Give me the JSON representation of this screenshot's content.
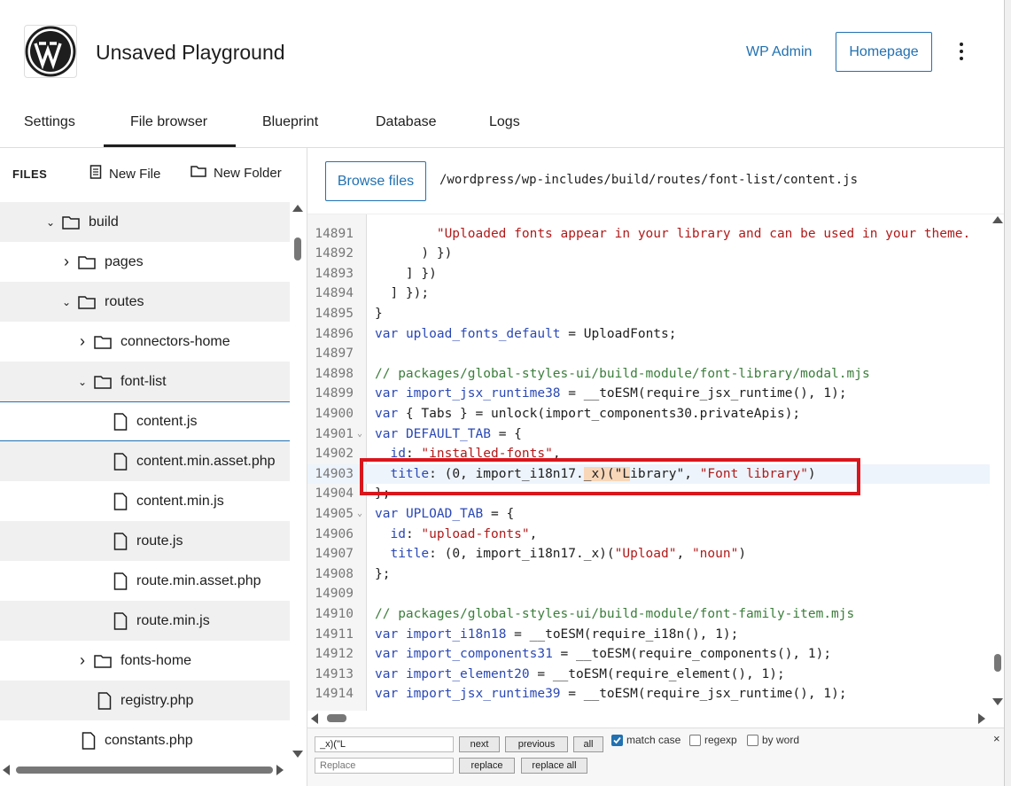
{
  "header": {
    "title": "Unsaved Playground",
    "wp_admin": "WP Admin",
    "homepage": "Homepage"
  },
  "tabs": [
    {
      "label": "Settings"
    },
    {
      "label": "File browser",
      "active": true
    },
    {
      "label": "Blueprint"
    },
    {
      "label": "Database"
    },
    {
      "label": "Logs"
    }
  ],
  "sidebar": {
    "files_label": "FILES",
    "new_file": "New File",
    "new_folder": "New Folder",
    "tree": [
      {
        "name": "build",
        "type": "folder",
        "expanded": true,
        "depth": 0
      },
      {
        "name": "pages",
        "type": "folder",
        "expanded": false,
        "depth": 1
      },
      {
        "name": "routes",
        "type": "folder",
        "expanded": true,
        "depth": 1
      },
      {
        "name": "connectors-home",
        "type": "folder",
        "expanded": false,
        "depth": 2
      },
      {
        "name": "font-list",
        "type": "folder",
        "expanded": true,
        "depth": 2
      },
      {
        "name": "content.js",
        "type": "file",
        "depth": 3,
        "selected": true
      },
      {
        "name": "content.min.asset.php",
        "type": "file",
        "depth": 3
      },
      {
        "name": "content.min.js",
        "type": "file",
        "depth": 3
      },
      {
        "name": "route.js",
        "type": "file",
        "depth": 3
      },
      {
        "name": "route.min.asset.php",
        "type": "file",
        "depth": 3
      },
      {
        "name": "route.min.js",
        "type": "file",
        "depth": 3
      },
      {
        "name": "fonts-home",
        "type": "folder",
        "expanded": false,
        "depth": 2
      },
      {
        "name": "registry.php",
        "type": "file",
        "depth": 2
      },
      {
        "name": "constants.php",
        "type": "file",
        "depth": 1
      }
    ]
  },
  "editor": {
    "browse_files": "Browse files",
    "path": "/wordpress/wp-includes/build/routes/font-list/content.js",
    "active_line": "14903",
    "lines": [
      {
        "n": "14891",
        "html": "        <span class='str'>\"Uploaded fonts appear in your library and can be used in your theme.</span>"
      },
      {
        "n": "14892",
        "html": "      ) })"
      },
      {
        "n": "14893",
        "html": "    ] })"
      },
      {
        "n": "14894",
        "html": "  ] });"
      },
      {
        "n": "14895",
        "html": "}"
      },
      {
        "n": "14896",
        "html": "<span class='kw'>var</span> <span class='kw'>upload_fonts_default</span> = UploadFonts;"
      },
      {
        "n": "14897",
        "html": ""
      },
      {
        "n": "14898",
        "html": "<span class='cmt'>// packages/global-styles-ui/build-module/font-library/modal.mjs</span>"
      },
      {
        "n": "14899",
        "html": "<span class='kw'>var</span> <span class='kw'>import_jsx_runtime38</span> = __toESM(require_jsx_runtime(), <span class='def'>1</span>);"
      },
      {
        "n": "14900",
        "html": "<span class='kw'>var</span> { Tabs } = unlock(import_components30.privateApis);"
      },
      {
        "n": "14901",
        "fold": true,
        "html": "<span class='kw'>var</span> <span class='kw'>DEFAULT_TAB</span> = {"
      },
      {
        "n": "14902",
        "html": "  <span class='kw'>id</span>: <span class='str'>\"installed-fonts\"</span>,"
      },
      {
        "n": "14903",
        "html": "  <span class='kw'>title</span>: (0, import_i18n17.<span class='hl'>_x)(\"L</span>ibrary\", <span class='str'>\"Font library\"</span>)"
      },
      {
        "n": "14904",
        "html": "};"
      },
      {
        "n": "14905",
        "fold": true,
        "html": "<span class='kw'>var</span> <span class='kw'>UPLOAD_TAB</span> = {"
      },
      {
        "n": "14906",
        "html": "  <span class='kw'>id</span>: <span class='str'>\"upload-fonts\"</span>,"
      },
      {
        "n": "14907",
        "html": "  <span class='kw'>title</span>: (0, import_i18n17._x)(<span class='str'>\"Upload\"</span>, <span class='str'>\"noun\"</span>)"
      },
      {
        "n": "14908",
        "html": "};"
      },
      {
        "n": "14909",
        "html": ""
      },
      {
        "n": "14910",
        "html": "<span class='cmt'>// packages/global-styles-ui/build-module/font-family-item.mjs</span>"
      },
      {
        "n": "14911",
        "html": "<span class='kw'>var</span> <span class='kw'>import_i18n18</span> = __toESM(require_i18n(), 1);"
      },
      {
        "n": "14912",
        "html": "<span class='kw'>var</span> <span class='kw'>import_components31</span> = __toESM(require_components(), 1);"
      },
      {
        "n": "14913",
        "html": "<span class='kw'>var</span> <span class='kw'>import_element20</span> = __toESM(require_element(), 1);"
      },
      {
        "n": "14914",
        "html": "<span class='kw'>var</span> <span class='kw'>import_jsx_runtime39</span> = __toESM(require_jsx_runtime(), 1);"
      }
    ]
  },
  "search": {
    "find_value": "_x)(\"L",
    "replace_placeholder": "Replace",
    "next": "next",
    "previous": "previous",
    "all": "all",
    "match_case": "match case",
    "match_case_checked": true,
    "regexp": "regexp",
    "by_word": "by word",
    "replace": "replace",
    "replace_all": "replace all",
    "close": "×"
  }
}
